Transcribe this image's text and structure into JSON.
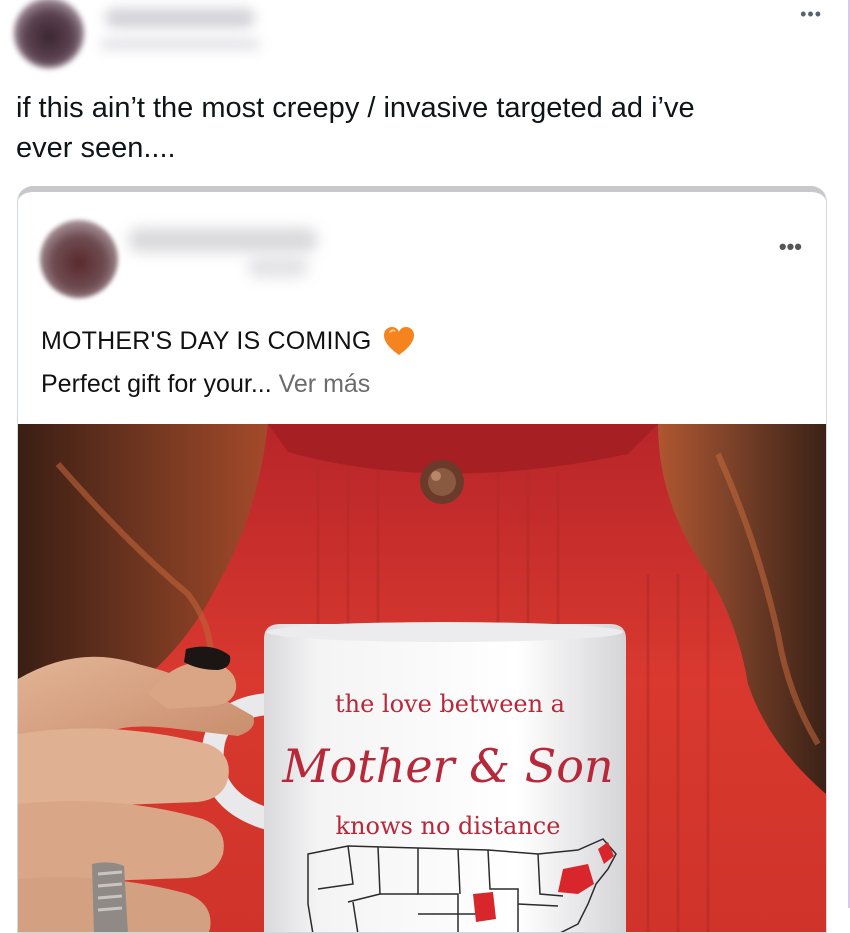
{
  "tweet": {
    "more_icon": "more-horizontal-icon",
    "text_line1": "if this ain’t the most creepy / invasive targeted ad i’ve",
    "text_line2": "ever seen...."
  },
  "ad_card": {
    "more_icon": "more-horizontal-icon",
    "headline": "MOTHER'S DAY IS COMING",
    "headline_icon": "orange-heart-icon",
    "body_text": "Perfect gift for your... ",
    "see_more": "Ver más",
    "mug": {
      "line1": "the love between a",
      "line2": "Mother & Son",
      "line3": "knows no distance"
    }
  },
  "colors": {
    "sweater_red": "#d63a2f",
    "mug_text_red": "#b7283a",
    "heart_orange": "#f5841f"
  }
}
